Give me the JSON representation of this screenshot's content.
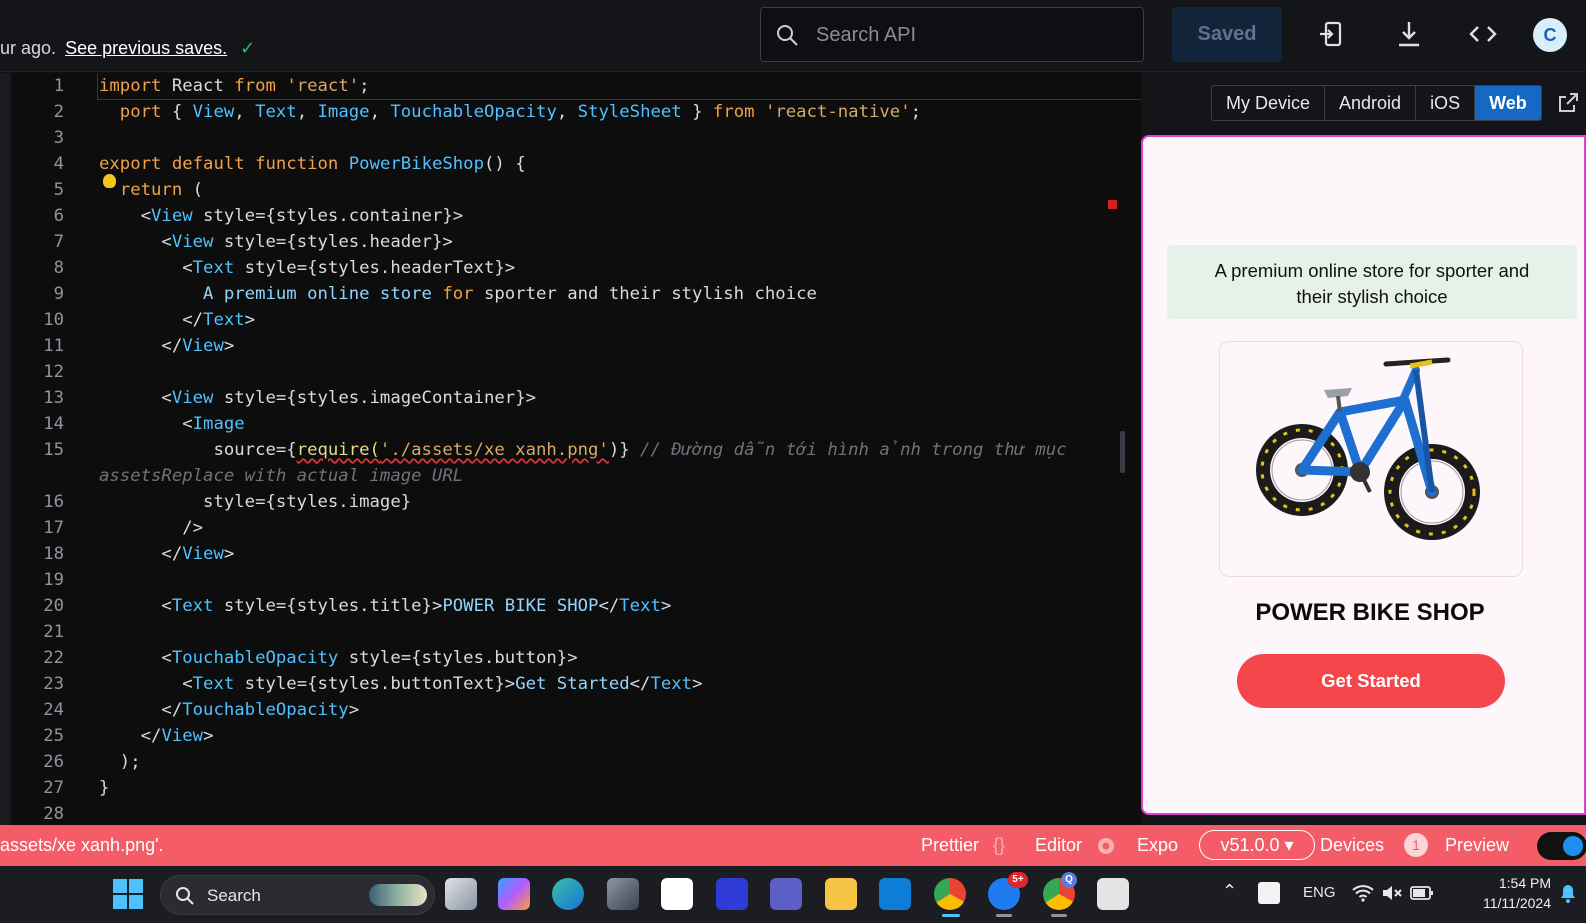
{
  "topbar": {
    "save_status": "ur ago.",
    "see_previous": "See previous saves.",
    "check": "✓",
    "search_placeholder": "Search API",
    "saved_label": "Saved",
    "avatar_letter": "C"
  },
  "editor": {
    "lines": [
      {
        "n": "1"
      },
      {
        "n": "2"
      },
      {
        "n": "3"
      },
      {
        "n": "4"
      },
      {
        "n": "5"
      },
      {
        "n": "6"
      },
      {
        "n": "7"
      },
      {
        "n": "8"
      },
      {
        "n": "9"
      },
      {
        "n": "10"
      },
      {
        "n": "11"
      },
      {
        "n": "12"
      },
      {
        "n": "13"
      },
      {
        "n": "14"
      },
      {
        "n": "15"
      },
      {
        "n": ""
      },
      {
        "n": "16"
      },
      {
        "n": "17"
      },
      {
        "n": "18"
      },
      {
        "n": "19"
      },
      {
        "n": "20"
      },
      {
        "n": "21"
      },
      {
        "n": "22"
      },
      {
        "n": "23"
      },
      {
        "n": "24"
      },
      {
        "n": "25"
      },
      {
        "n": "26"
      },
      {
        "n": "27"
      },
      {
        "n": "28"
      }
    ],
    "code": {
      "l1": [
        "import",
        " React ",
        "from",
        " ",
        "'react'",
        ";"
      ],
      "l2": [
        "  port",
        " { ",
        "View",
        ", ",
        "Text",
        ", ",
        "Image",
        ", ",
        "TouchableOpacity",
        ", ",
        "StyleSheet",
        " } ",
        "from",
        " ",
        "'react-native'",
        ";"
      ],
      "l4": [
        "export",
        " ",
        "default",
        " ",
        "function",
        " ",
        "PowerBikeShop",
        "() {"
      ],
      "l5": [
        "  ",
        "return",
        " ("
      ],
      "l6": [
        "    <",
        "View",
        " style={styles.container}>"
      ],
      "l7": [
        "      <",
        "View",
        " style={styles.header}>"
      ],
      "l8": [
        "        <",
        "Text",
        " style={styles.headerText}>"
      ],
      "l9": [
        "          ",
        "A premium online store ",
        "for",
        " sporter and their stylish choice"
      ],
      "l10": [
        "        </",
        "Text",
        ">"
      ],
      "l11": [
        "      </",
        "View",
        ">"
      ],
      "l13": [
        "      <",
        "View",
        " style={styles.imageContainer}>"
      ],
      "l14": [
        "        <",
        "Image"
      ],
      "l15": [
        "           source={",
        "require(",
        "'./assets/xe xanh.png'",
        ")} ",
        "// Đường dẫn tới hình ảnh trong thư mục"
      ],
      "l15b": "assetsReplace with actual image URL",
      "l16": "          style={styles.image}",
      "l17": "        />",
      "l18": [
        "      </",
        "View",
        ">"
      ],
      "l20": [
        "      <",
        "Text",
        " style={styles.title}>",
        "POWER BIKE SHOP",
        "</",
        "Text",
        ">"
      ],
      "l22": [
        "      <",
        "TouchableOpacity",
        " style={styles.button}>"
      ],
      "l23": [
        "        <",
        "Text",
        " style={styles.buttonText}>",
        "Get Started",
        "</",
        "Text",
        ">"
      ],
      "l24": [
        "      </",
        "TouchableOpacity",
        ">"
      ],
      "l25": [
        "    </",
        "View",
        ">"
      ],
      "l26": "  );",
      "l27": "}"
    }
  },
  "preview": {
    "platforms": [
      "My Device",
      "Android",
      "iOS",
      "Web"
    ],
    "active_platform": "Web",
    "header_text_1": "A premium online store for sporter and",
    "header_text_2": "their stylish choice",
    "title": "POWER BIKE SHOP",
    "button": "Get Started",
    "colors": {
      "button": "#f5474b",
      "header_bg": "#e6f1ea",
      "frame": "#e13ecb"
    }
  },
  "statusbar": {
    "message": "assets/xe xanh.png'.",
    "prettier": "Prettier",
    "prettier_icon": "{}",
    "editor": "Editor",
    "expo": "Expo",
    "version": "v51.0.0 ▾",
    "devices": "Devices",
    "devices_count": "1",
    "preview": "Preview"
  },
  "taskbar": {
    "search": "Search",
    "lang": "ENG",
    "time": "1:54 PM",
    "date": "11/11/2024",
    "zalo_badge": "5+",
    "chrome_badge": "Q"
  }
}
